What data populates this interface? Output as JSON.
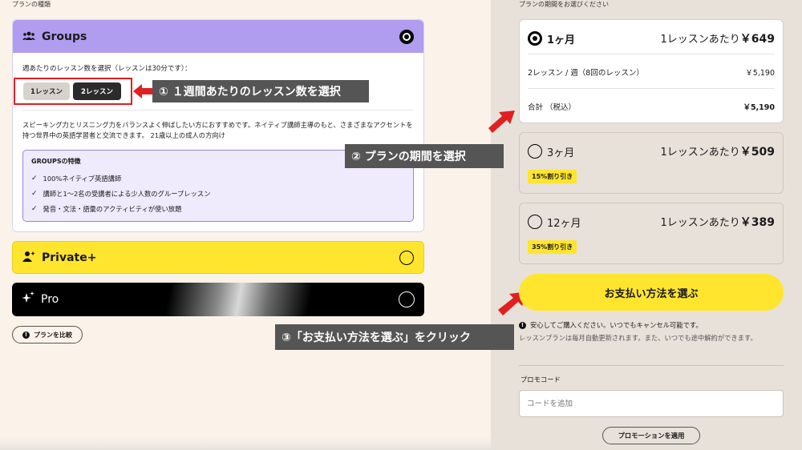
{
  "plan_section": {
    "label": "プランの種類",
    "groups": {
      "name": "Groups",
      "lesson_prompt": "週あたりのレッスン数を選択（レッスンは30分です）：",
      "lesson_options": [
        "1レッスン",
        "2レッスン"
      ],
      "description": "スピーキング力とリスニング力をバランスよく伸ばしたい方におすすめです。ネイティブ講師主導のもと、さまざまなアクセントを持つ世界中の英語学習者と交流できます。 21歳以上の成人の方向け",
      "features_title": "GROUPSの特徴",
      "features": [
        "100%ネイティブ英語講師",
        "講師と1〜2名の受講者による少人数のグループレッスン",
        "発音・文法・語彙のアクティビティが使い放題"
      ]
    },
    "private_plus": {
      "name": "Private+"
    },
    "pro": {
      "name": "Pro"
    },
    "compare_button": "プランを比較"
  },
  "annotations": {
    "step1": "① １週間あたりのレッスン数を選択",
    "step2": "② プランの期間を選択",
    "step3": "③「お支払い方法を選ぶ」をクリック"
  },
  "period_section": {
    "label": "プランの期間をお選びください",
    "options": [
      {
        "label": "1ヶ月",
        "per_lesson_prefix": "1レッスンあたり",
        "per_lesson_price": "￥649"
      },
      {
        "label": "3ヶ月",
        "per_lesson_prefix": "1レッスンあたり",
        "per_lesson_price": "￥509",
        "discount": "15%割り引き"
      },
      {
        "label": "12ヶ月",
        "per_lesson_prefix": "1レッスンあたり",
        "per_lesson_price": "￥389",
        "discount": "35%割り引き"
      }
    ],
    "detail_line": "2レッスン / 週（8回のレッスン）",
    "detail_amount": "￥5,190",
    "total_label": "合計 （税込）",
    "total_amount": "￥5,190"
  },
  "payment": {
    "button": "お支払い方法を選ぶ",
    "safe_note": "安心してご購入ください。いつでもキャンセル可能です。",
    "renew_note": "レッスンプランは毎月自動更新されます。また、いつでも途中解約ができます。"
  },
  "promo": {
    "label": "プロモコード",
    "placeholder": "コードを追加",
    "apply_button": "プロモーションを適用"
  },
  "colors": {
    "groups_header": "#b19df0",
    "private_yellow": "#ffe52e",
    "annotation_red": "#e02020"
  }
}
